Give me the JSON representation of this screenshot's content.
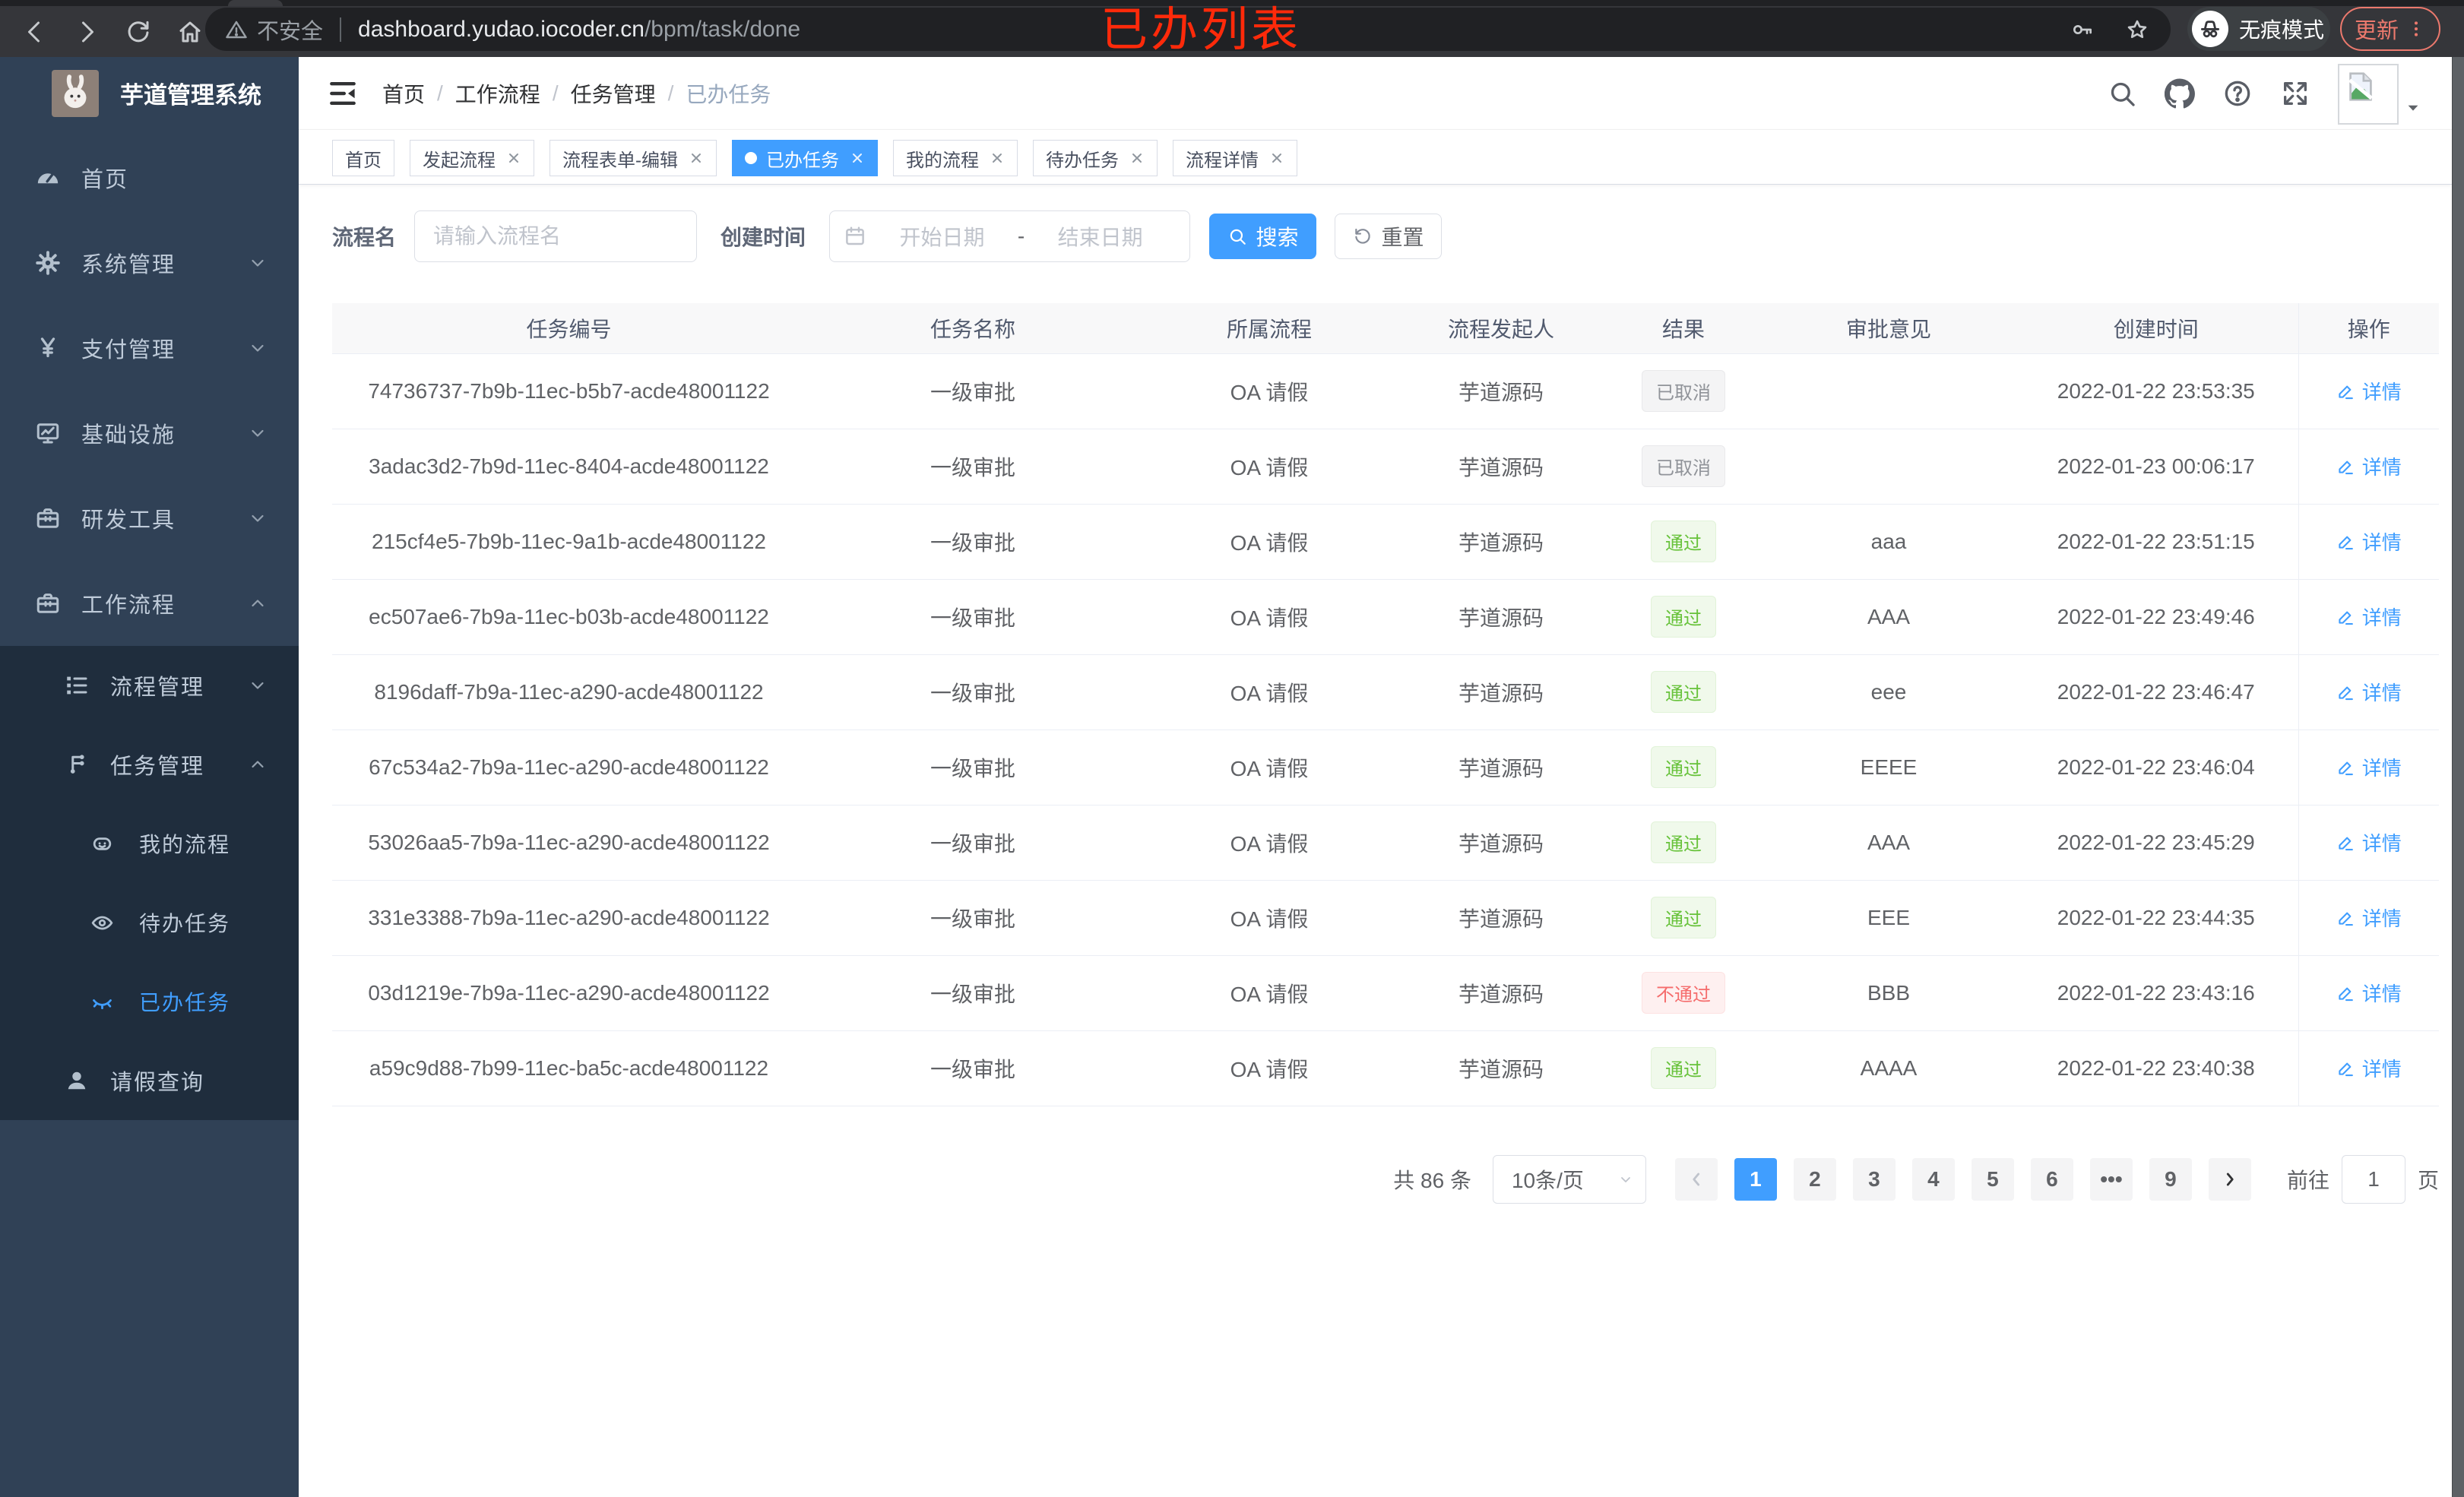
{
  "browser": {
    "nav_icons": [
      {
        "icon": "back-icon"
      },
      {
        "icon": "forward-icon"
      },
      {
        "icon": "reload-icon"
      },
      {
        "icon": "home-icon"
      }
    ],
    "security_label": "不安全",
    "url_host": "dashboard.yudao.iocoder.cn",
    "url_path": "/bpm/task/done",
    "incognito_label": "无痕模式",
    "update_label": "更新"
  },
  "annotation": {
    "text": "已办列表",
    "color": "#ff2a0a"
  },
  "sidebar": {
    "title": "芋道管理系统",
    "menu": [
      {
        "label": "首页",
        "icon": "dashboard-icon",
        "level": 1
      },
      {
        "label": "系统管理",
        "icon": "gear-icon",
        "level": 1,
        "chevron": "chevron-down-icon"
      },
      {
        "label": "支付管理",
        "icon": "yen-icon",
        "level": 1,
        "chevron": "chevron-down-icon"
      },
      {
        "label": "基础设施",
        "icon": "monitor-icon",
        "level": 1,
        "chevron": "chevron-down-icon"
      },
      {
        "label": "研发工具",
        "icon": "toolbox-icon",
        "level": 1,
        "chevron": "chevron-down-icon"
      },
      {
        "label": "工作流程",
        "icon": "toolbox-icon",
        "level": 1,
        "chevron": "chevron-up-icon"
      },
      {
        "label": "流程管理",
        "icon": "tree-icon",
        "level": 2,
        "chevron": "chevron-down-icon"
      },
      {
        "label": "任务管理",
        "icon": "share-icon",
        "level": 2,
        "chevron": "chevron-up-icon"
      },
      {
        "label": "我的流程",
        "icon": "robot-icon",
        "level": 3
      },
      {
        "label": "待办任务",
        "icon": "eye-icon",
        "level": 3
      },
      {
        "label": "已办任务",
        "icon": "eye-closed-icon",
        "level": 3,
        "active": true
      },
      {
        "label": "请假查询",
        "icon": "user-icon",
        "level": 2
      }
    ]
  },
  "header": {
    "breadcrumb": [
      {
        "label": "首页"
      },
      {
        "label": "工作流程"
      },
      {
        "label": "任务管理"
      },
      {
        "label": "已办任务",
        "muted": true
      }
    ],
    "action_icons": [
      {
        "icon": "search-icon"
      },
      {
        "icon": "github-icon"
      },
      {
        "icon": "question-icon"
      },
      {
        "icon": "fullscreen-icon"
      },
      {
        "icon": "fontsize-icon"
      }
    ]
  },
  "tabs": [
    {
      "label": "首页"
    },
    {
      "label": "发起流程",
      "closable": true
    },
    {
      "label": "流程表单-编辑",
      "closable": true
    },
    {
      "label": "已办任务",
      "closable": true,
      "active": true
    },
    {
      "label": "我的流程",
      "closable": true
    },
    {
      "label": "待办任务",
      "closable": true
    },
    {
      "label": "流程详情",
      "closable": true
    }
  ],
  "filter": {
    "name_label": "流程名",
    "name_placeholder": "请输入流程名",
    "time_label": "创建时间",
    "start_placeholder": "开始日期",
    "range_separator": "-",
    "end_placeholder": "结束日期",
    "search_label": "搜索",
    "reset_label": "重置"
  },
  "table": {
    "columns": [
      "任务编号",
      "任务名称",
      "所属流程",
      "流程发起人",
      "结果",
      "审批意见",
      "创建时间",
      "操作"
    ],
    "detail_label": "详情",
    "rows": [
      {
        "id": "74736737-7b9b-11ec-b5b7-acde48001122",
        "name": "一级审批",
        "process": "OA 请假",
        "starter": "芋道源码",
        "result": {
          "label": "已取消",
          "type": "info"
        },
        "comment": "",
        "created": "2022-01-22 23:53:35"
      },
      {
        "id": "3adac3d2-7b9d-11ec-8404-acde48001122",
        "name": "一级审批",
        "process": "OA 请假",
        "starter": "芋道源码",
        "result": {
          "label": "已取消",
          "type": "info"
        },
        "comment": "",
        "created": "2022-01-23 00:06:17"
      },
      {
        "id": "215cf4e5-7b9b-11ec-9a1b-acde48001122",
        "name": "一级审批",
        "process": "OA 请假",
        "starter": "芋道源码",
        "result": {
          "label": "通过",
          "type": "success"
        },
        "comment": "aaa",
        "created": "2022-01-22 23:51:15"
      },
      {
        "id": "ec507ae6-7b9a-11ec-b03b-acde48001122",
        "name": "一级审批",
        "process": "OA 请假",
        "starter": "芋道源码",
        "result": {
          "label": "通过",
          "type": "success"
        },
        "comment": "AAA",
        "created": "2022-01-22 23:49:46"
      },
      {
        "id": "8196daff-7b9a-11ec-a290-acde48001122",
        "name": "一级审批",
        "process": "OA 请假",
        "starter": "芋道源码",
        "result": {
          "label": "通过",
          "type": "success"
        },
        "comment": "eee",
        "created": "2022-01-22 23:46:47"
      },
      {
        "id": "67c534a2-7b9a-11ec-a290-acde48001122",
        "name": "一级审批",
        "process": "OA 请假",
        "starter": "芋道源码",
        "result": {
          "label": "通过",
          "type": "success"
        },
        "comment": "EEEE",
        "created": "2022-01-22 23:46:04"
      },
      {
        "id": "53026aa5-7b9a-11ec-a290-acde48001122",
        "name": "一级审批",
        "process": "OA 请假",
        "starter": "芋道源码",
        "result": {
          "label": "通过",
          "type": "success"
        },
        "comment": "AAA",
        "created": "2022-01-22 23:45:29"
      },
      {
        "id": "331e3388-7b9a-11ec-a290-acde48001122",
        "name": "一级审批",
        "process": "OA 请假",
        "starter": "芋道源码",
        "result": {
          "label": "通过",
          "type": "success"
        },
        "comment": "EEE",
        "created": "2022-01-22 23:44:35"
      },
      {
        "id": "03d1219e-7b9a-11ec-a290-acde48001122",
        "name": "一级审批",
        "process": "OA 请假",
        "starter": "芋道源码",
        "result": {
          "label": "不通过",
          "type": "danger"
        },
        "comment": "BBB",
        "created": "2022-01-22 23:43:16"
      },
      {
        "id": "a59c9d88-7b99-11ec-ba5c-acde48001122",
        "name": "一级审批",
        "process": "OA 请假",
        "starter": "芋道源码",
        "result": {
          "label": "通过",
          "type": "success"
        },
        "comment": "AAAA",
        "created": "2022-01-22 23:40:38"
      }
    ]
  },
  "pagination": {
    "total_label": "共 86 条",
    "page_size": "10条/页",
    "pages": [
      {
        "label": "1",
        "active": true
      },
      {
        "label": "2"
      },
      {
        "label": "3"
      },
      {
        "label": "4"
      },
      {
        "label": "5"
      },
      {
        "label": "6"
      },
      {
        "label": "•••"
      },
      {
        "label": "9"
      }
    ],
    "goto_label": "前往",
    "goto_value": "1",
    "goto_unit": "页"
  }
}
